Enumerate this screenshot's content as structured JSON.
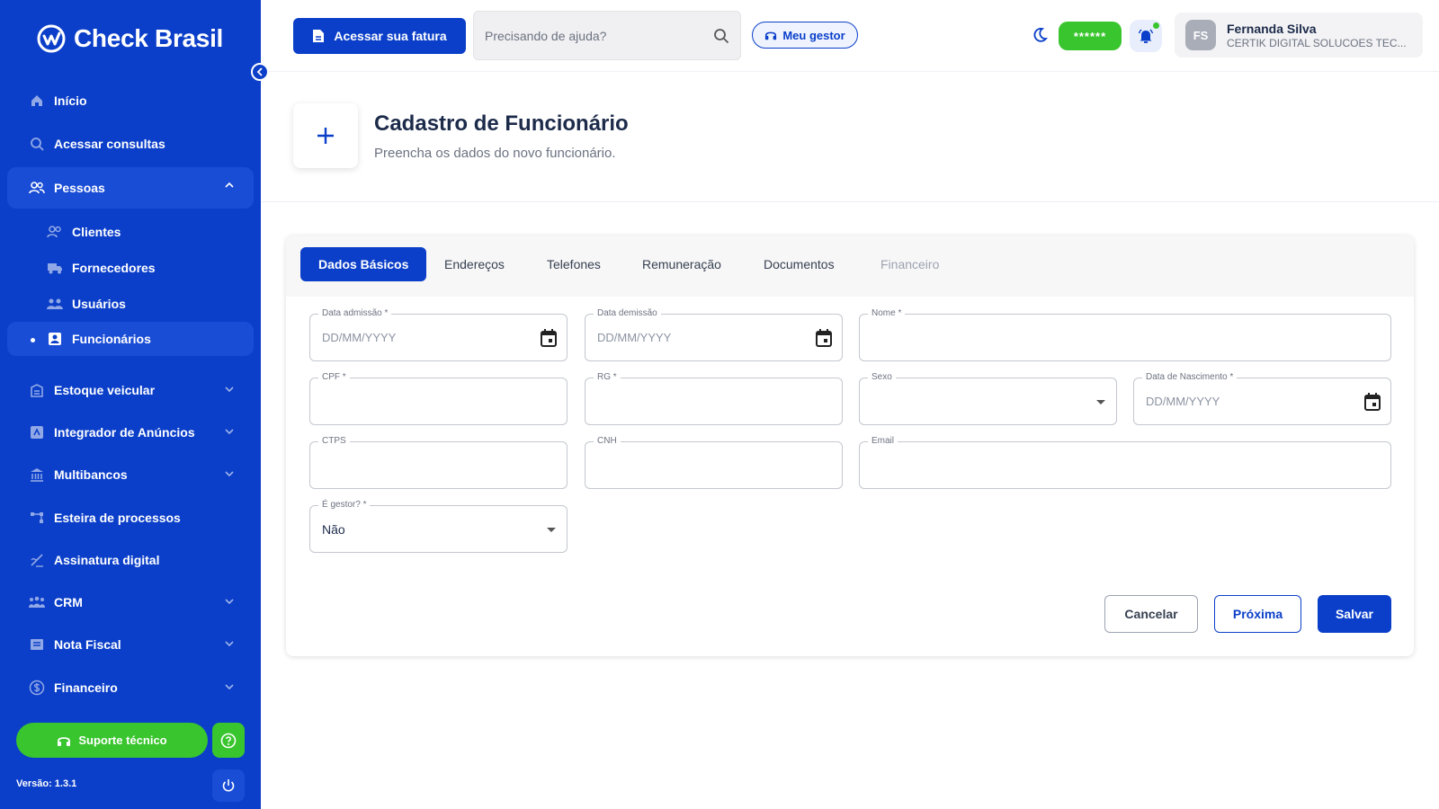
{
  "brand": {
    "name": "Check Brasil"
  },
  "sidebar": {
    "items": [
      {
        "label": "Início"
      },
      {
        "label": "Acessar consultas"
      },
      {
        "label": "Pessoas"
      },
      {
        "label": "Clientes"
      },
      {
        "label": "Fornecedores"
      },
      {
        "label": "Usuários"
      },
      {
        "label": "Funcionários"
      },
      {
        "label": "Estoque veicular"
      },
      {
        "label": "Integrador de Anúncios"
      },
      {
        "label": "Multibancos"
      },
      {
        "label": "Esteira de processos"
      },
      {
        "label": "Assinatura digital"
      },
      {
        "label": "CRM"
      },
      {
        "label": "Nota Fiscal"
      },
      {
        "label": "Financeiro"
      }
    ],
    "support_label": "Suporte técnico",
    "version": "Versão: 1.3.1"
  },
  "topbar": {
    "invoice_label": "Acessar sua fatura",
    "search_placeholder": "Precisando de ajuda?",
    "manager_label": "Meu gestor",
    "masked_pill": "******",
    "user": {
      "initials": "FS",
      "name": "Fernanda Silva",
      "company": "CERTIK DIGITAL SOLUCOES TEC..."
    }
  },
  "page": {
    "title": "Cadastro de Funcionário",
    "subtitle": "Preencha os dados do novo funcionário."
  },
  "tabs": [
    {
      "label": "Dados Básicos"
    },
    {
      "label": "Endereços"
    },
    {
      "label": "Telefones"
    },
    {
      "label": "Remuneração"
    },
    {
      "label": "Documentos"
    },
    {
      "label": "Financeiro"
    }
  ],
  "form": {
    "data_admissao": {
      "label": "Data admissão *",
      "placeholder": "DD/MM/YYYY"
    },
    "data_demissao": {
      "label": "Data demissão",
      "placeholder": "DD/MM/YYYY"
    },
    "nome": {
      "label": "Nome *"
    },
    "cpf": {
      "label": "CPF *"
    },
    "rg": {
      "label": "RG *"
    },
    "sexo": {
      "label": "Sexo"
    },
    "data_nascimento": {
      "label": "Data de Nascimento *",
      "placeholder": "DD/MM/YYYY"
    },
    "ctps": {
      "label": "CTPS"
    },
    "cnh": {
      "label": "CNH"
    },
    "email": {
      "label": "Email"
    },
    "gestor": {
      "label": "É gestor? *",
      "value": "Não"
    }
  },
  "actions": {
    "cancel": "Cancelar",
    "next": "Próxima",
    "save": "Salvar"
  },
  "colors": {
    "primary": "#0b3fc9",
    "success": "#39c52e"
  }
}
